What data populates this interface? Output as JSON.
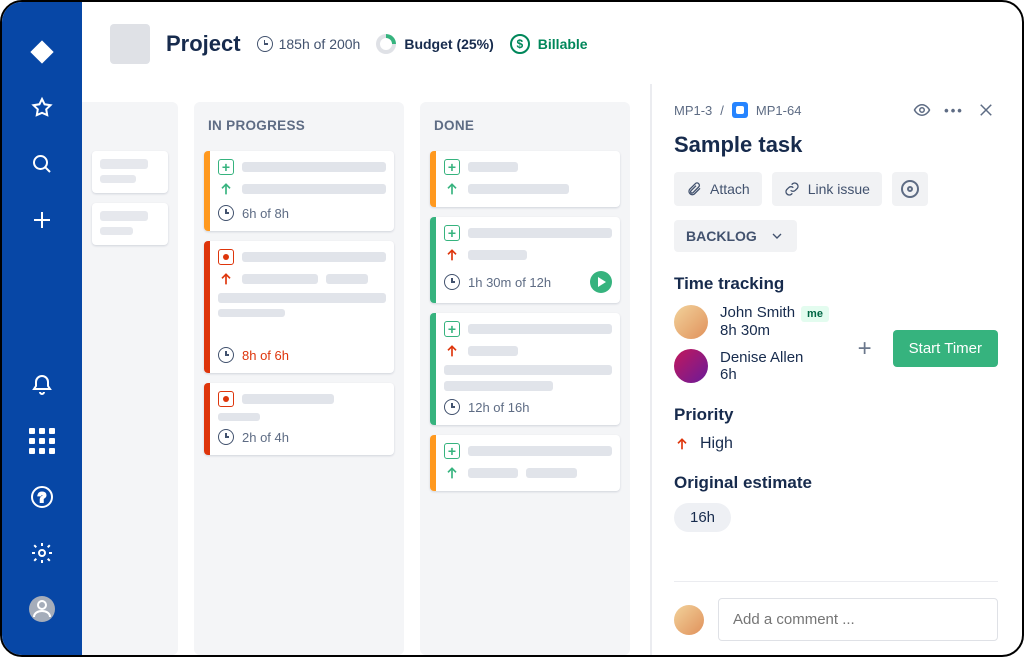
{
  "sidebar": {
    "icons": [
      "diamond-icon",
      "star-icon",
      "search-icon",
      "plus-icon",
      "bell-icon",
      "apps-icon",
      "help-icon",
      "settings-gear-icon",
      "profile-avatar-icon"
    ]
  },
  "header": {
    "project_title": "Project",
    "hours": "185h of 200h",
    "budget_label": "Budget (25%)",
    "billable_label": "Billable"
  },
  "board": {
    "columns": [
      {
        "title": "IN PROGRESS",
        "cards": [
          {
            "strip": "orange",
            "icons": [
              "plus",
              "up-green"
            ],
            "time": "6h of 8h",
            "over": false
          },
          {
            "strip": "red",
            "icons": [
              "rec",
              "up-red"
            ],
            "time": "8h of 6h",
            "over": true
          },
          {
            "strip": "red",
            "icons": [
              "rec"
            ],
            "time": "2h of 4h",
            "over": false
          }
        ]
      },
      {
        "title": "DONE",
        "cards": [
          {
            "strip": "orange",
            "icons": [
              "plus",
              "up-green"
            ],
            "time": "",
            "over": false
          },
          {
            "strip": "green",
            "icons": [
              "plus",
              "up-red"
            ],
            "time": "1h 30m of 12h",
            "over": false,
            "play": true
          },
          {
            "strip": "green",
            "icons": [
              "plus",
              "up-red"
            ],
            "time": "12h of 16h",
            "over": false
          },
          {
            "strip": "orange",
            "icons": [
              "plus",
              "up-green"
            ],
            "time": "",
            "over": false
          }
        ]
      }
    ]
  },
  "detail": {
    "breadcrumb_parent": "MP1-3",
    "breadcrumb_child": "MP1-64",
    "title": "Sample task",
    "actions": {
      "attach": "Attach",
      "link": "Link issue"
    },
    "status": "BACKLOG",
    "time_tracking_label": "Time tracking",
    "people": [
      {
        "name": "John Smith",
        "time": "8h 30m",
        "me": true,
        "me_label": "me"
      },
      {
        "name": "Denise Allen",
        "time": "6h",
        "me": false
      }
    ],
    "start_timer": "Start Timer",
    "priority_label": "Priority",
    "priority_value": "High",
    "estimate_label": "Original estimate",
    "estimate_value": "16h",
    "comment_placeholder": "Add a comment ..."
  }
}
